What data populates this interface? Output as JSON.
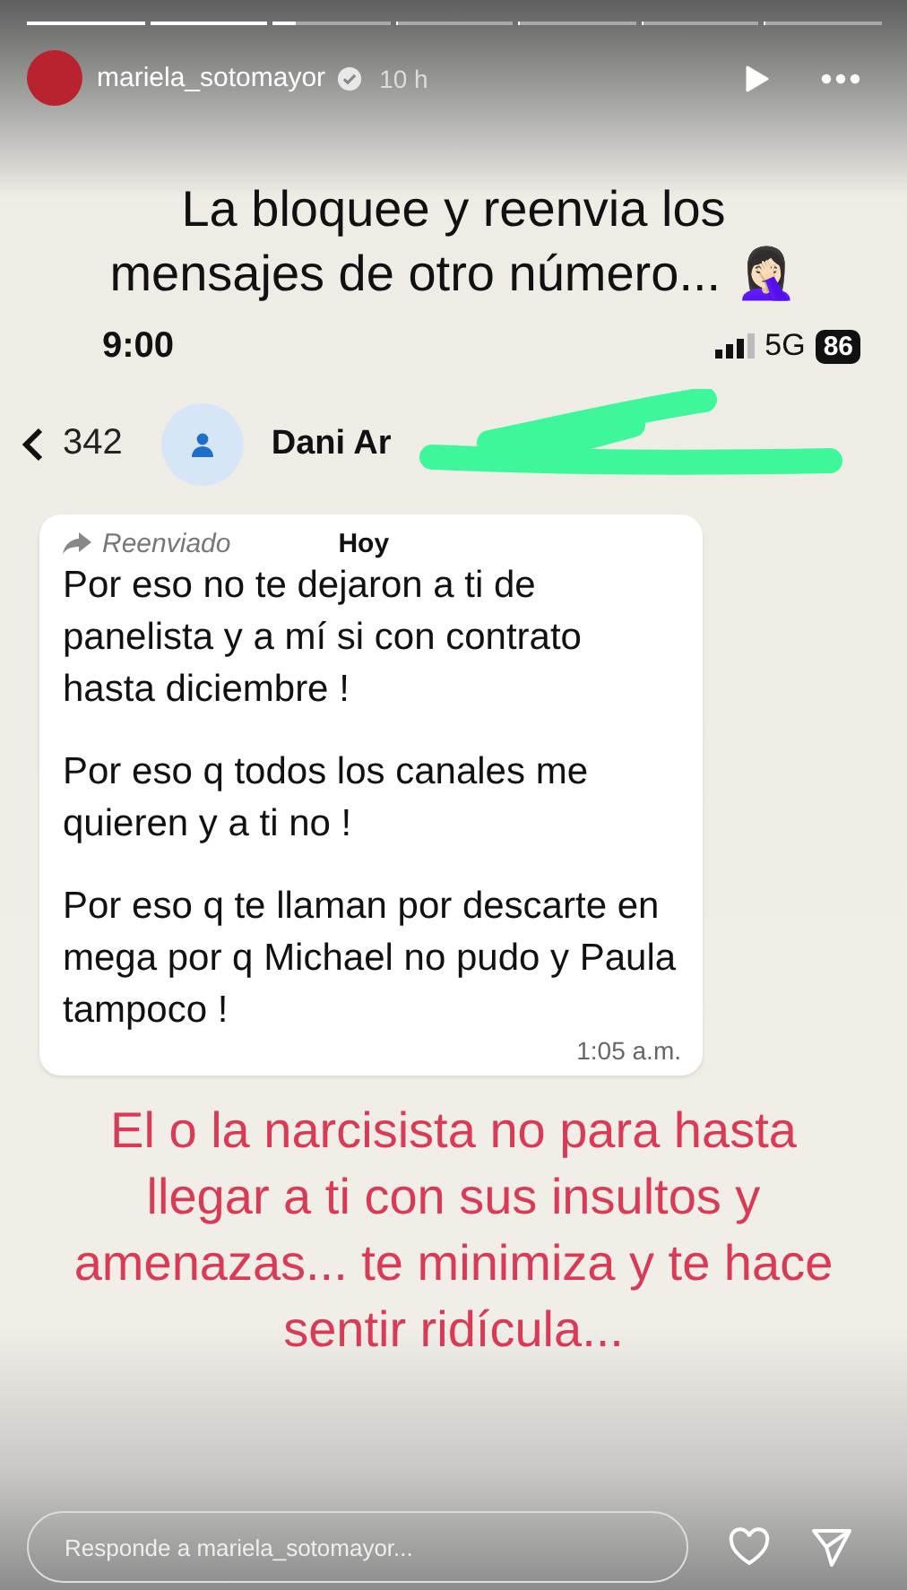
{
  "progress": [
    {
      "level": 1
    },
    {
      "level": 1
    },
    {
      "level": 0.2
    },
    {
      "level": 0
    },
    {
      "level": 0
    },
    {
      "level": 0
    },
    {
      "level": 0
    }
  ],
  "header": {
    "username": "mariela_sotomayor",
    "verified": true,
    "time": "10 h"
  },
  "caption_top": "La bloquee y reenvia los mensajes de otro número... 🤦🏻‍♀️",
  "phone_status": {
    "time": "9:00",
    "network": "5G",
    "battery": "86"
  },
  "chat_header": {
    "back_count": "342",
    "contact": "Dani Ar"
  },
  "message": {
    "forwarded": "Reenviado",
    "date_chip": "Hoy",
    "paragraphs": [
      "Por eso no te dejaron a ti de panelista y a mí si con contrato hasta diciembre !",
      "Por eso q todos los canales me quieren y a ti no !",
      "Por eso q te llaman por descarte en mega por q Michael no pudo y Paula tampoco !"
    ],
    "time": "1:05 a.m."
  },
  "caption_bottom": "El o la narcisista no para hasta llegar a ti con sus insultos y amenazas... te minimiza y te hace sentir ridícula...",
  "reply": {
    "placeholder": "Responde a mariela_sotomayor..."
  }
}
